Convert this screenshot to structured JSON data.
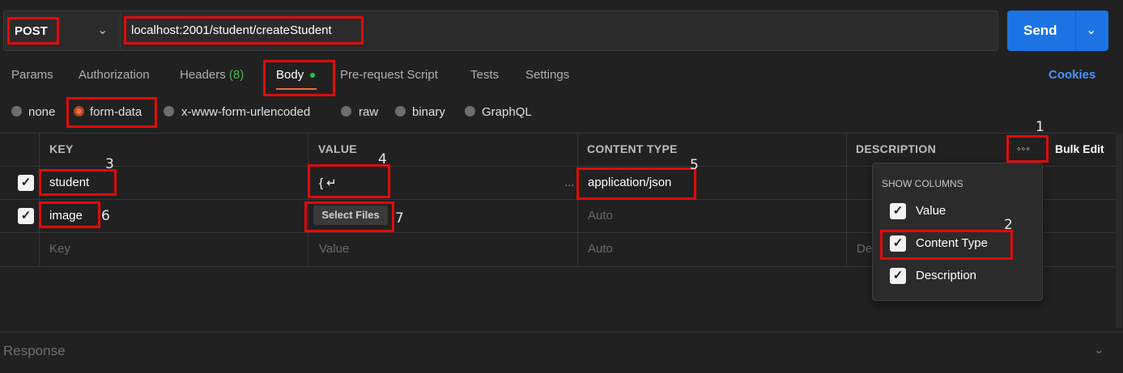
{
  "request": {
    "method": "POST",
    "url": "localhost:2001/student/createStudent",
    "send_label": "Send"
  },
  "tabs": [
    {
      "label": "Params"
    },
    {
      "label": "Authorization"
    },
    {
      "label": "Headers",
      "count": "(8)"
    },
    {
      "label": "Body"
    },
    {
      "label": "Pre-request Script"
    },
    {
      "label": "Tests"
    },
    {
      "label": "Settings"
    }
  ],
  "cookies_label": "Cookies",
  "body_types": [
    {
      "label": "none"
    },
    {
      "label": "form-data",
      "selected": true
    },
    {
      "label": "x-www-form-urlencoded"
    },
    {
      "label": "raw"
    },
    {
      "label": "binary"
    },
    {
      "label": "GraphQL"
    }
  ],
  "table": {
    "headers": {
      "key": "KEY",
      "value": "VALUE",
      "content_type": "CONTENT TYPE",
      "description": "DESCRIPTION"
    },
    "bulk_edit": "Bulk Edit",
    "rows": [
      {
        "key": "student",
        "value": "{ ↵",
        "ellipsis": "...",
        "content_type": "application/json"
      },
      {
        "key": "image",
        "value_button": "Select Files",
        "content_type_placeholder": "Auto"
      }
    ],
    "empty_row": {
      "key": "Key",
      "value": "Value",
      "content_type": "Auto",
      "description": "De"
    }
  },
  "columns_menu": {
    "title": "SHOW COLUMNS",
    "items": [
      {
        "label": "Value",
        "checked": true
      },
      {
        "label": "Content Type",
        "checked": true
      },
      {
        "label": "Description",
        "checked": true
      }
    ]
  },
  "annotations": [
    "1",
    "2",
    "3",
    "4",
    "5",
    "6",
    "7"
  ],
  "response_label": "Response",
  "colors": {
    "accent_send": "#1c74e4",
    "tab_underline": "#f26b3a",
    "highlight_box": "#e00b0b",
    "cookies": "#4a94ff"
  }
}
